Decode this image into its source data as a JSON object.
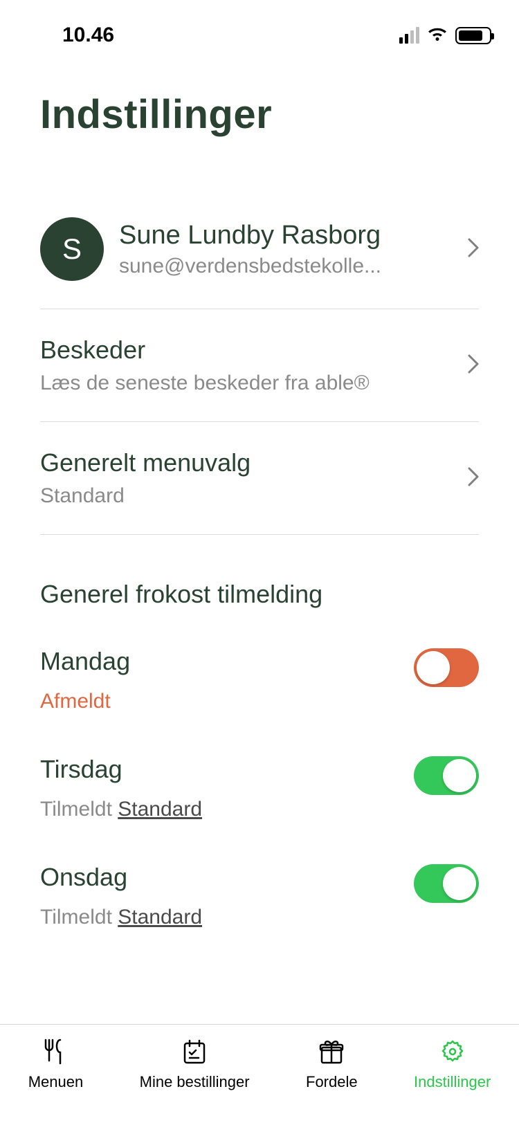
{
  "status": {
    "time": "10.46"
  },
  "page_title": "Indstillinger",
  "profile": {
    "initial": "S",
    "name": "Sune Lundby Rasborg",
    "email": "sune@verdensbedstekolle..."
  },
  "messages": {
    "title": "Beskeder",
    "subtitle": "Læs de seneste beskeder fra able®"
  },
  "menu_choice": {
    "title": "Generelt menuvalg",
    "value": "Standard"
  },
  "lunch_section": {
    "header": "Generel frokost tilmelding",
    "days": [
      {
        "name": "Mandag",
        "status_prefix": "Afmeldt",
        "status_value": "",
        "on": false
      },
      {
        "name": "Tirsdag",
        "status_prefix": "Tilmeldt ",
        "status_value": "Standard",
        "on": true
      },
      {
        "name": "Onsdag",
        "status_prefix": "Tilmeldt ",
        "status_value": "Standard",
        "on": true
      }
    ]
  },
  "tabs": {
    "menu": "Menuen",
    "orders": "Mine bestillinger",
    "benefits": "Fordele",
    "settings": "Indstillinger"
  }
}
